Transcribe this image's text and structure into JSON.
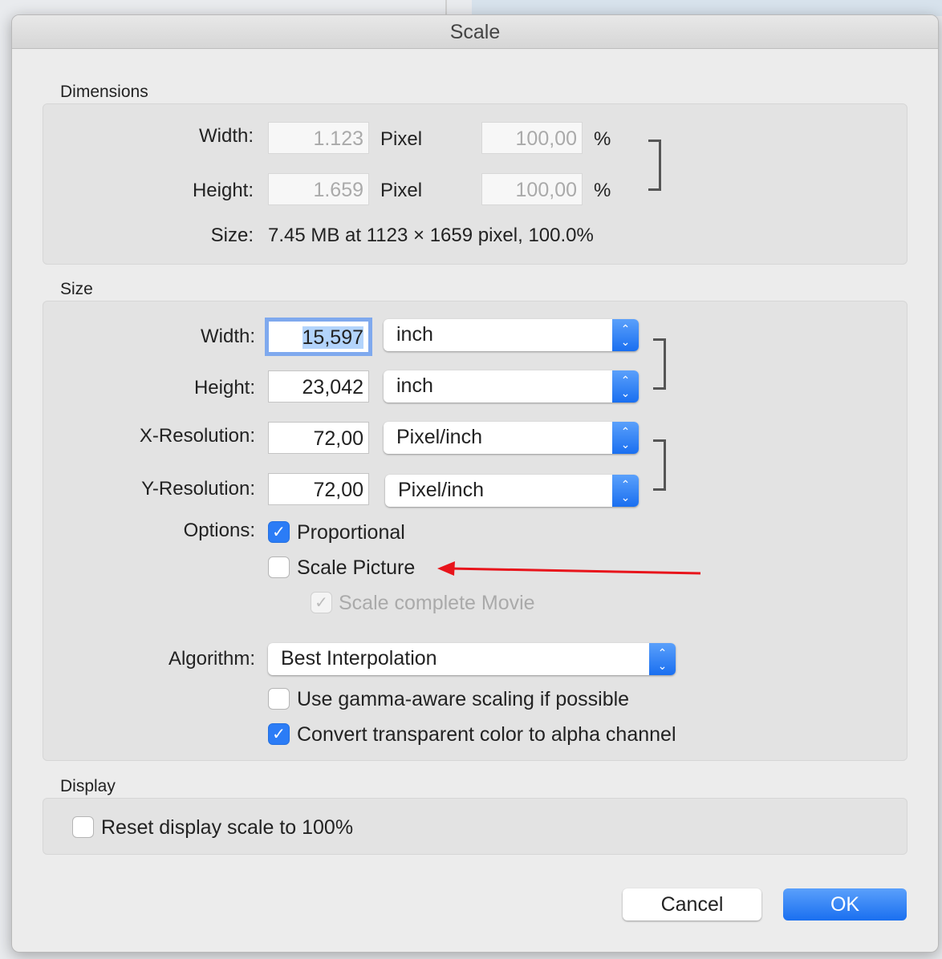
{
  "title": "Scale",
  "dimensions": {
    "section": "Dimensions",
    "width_label": "Width:",
    "width_value": "1.123",
    "width_unit": "Pixel",
    "width_pct": "100,00",
    "height_label": "Height:",
    "height_value": "1.659",
    "height_unit": "Pixel",
    "height_pct": "100,00",
    "pct_sign": "%",
    "size_label": "Size:",
    "size_value": "7.45 MB at 1123 × 1659 pixel, 100.0%"
  },
  "size": {
    "section": "Size",
    "width_label": "Width:",
    "width_value": "15,597",
    "width_unit": "inch",
    "height_label": "Height:",
    "height_value": "23,042",
    "height_unit": "inch",
    "xres_label": "X-Resolution:",
    "xres_value": "72,00",
    "xres_unit": "Pixel/inch",
    "yres_label": "Y-Resolution:",
    "yres_value": "72,00",
    "yres_unit": "Pixel/inch",
    "options_label": "Options:",
    "options": [
      {
        "label": "Proportional",
        "checked": true
      },
      {
        "label": "Scale Picture",
        "checked": false
      },
      {
        "label": "Scale complete Movie",
        "checked": true,
        "disabled": true
      }
    ],
    "algorithm_label": "Algorithm:",
    "algorithm_value": "Best Interpolation",
    "extra": [
      {
        "label": "Use gamma-aware scaling if possible",
        "checked": false
      },
      {
        "label": "Convert transparent color to alpha channel",
        "checked": true
      }
    ]
  },
  "display": {
    "section": "Display",
    "reset_label": "Reset display scale to 100%",
    "reset_checked": false
  },
  "buttons": {
    "cancel": "Cancel",
    "ok": "OK"
  },
  "colors": {
    "accent": "#2b7cf6",
    "annotation_arrow": "#e8141b"
  }
}
